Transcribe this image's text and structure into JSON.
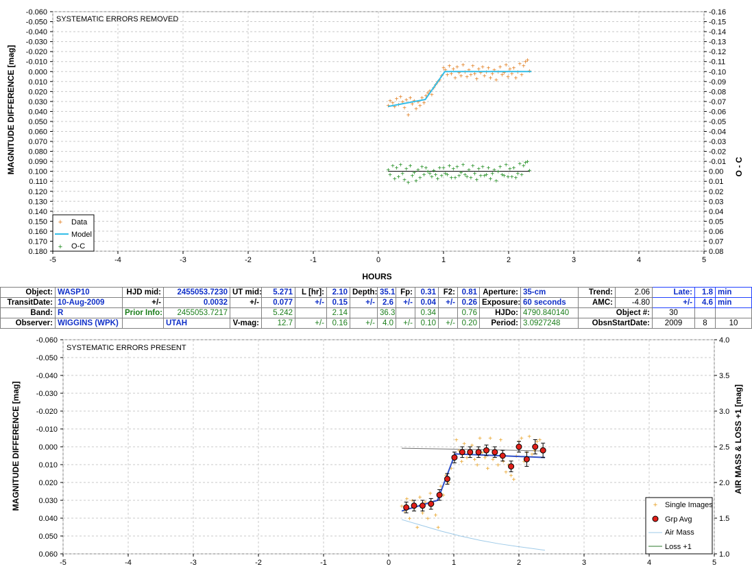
{
  "chart_data": [
    {
      "type": "scatter",
      "title": "SYSTEMATIC ERRORS REMOVED",
      "xlabel": "HOURS",
      "ylabel": "MAGNITUDE DIFFERENCE [mag]",
      "y2label": "O - C",
      "xlim": [
        -5,
        5
      ],
      "ylim": [
        -0.06,
        0.18
      ],
      "y2lim": [
        -0.16,
        0.08
      ],
      "y_inverted": true,
      "grid": true,
      "legend_position": "bottom-left",
      "x_ticks": [
        "-5",
        "-4",
        "-3",
        "-2",
        "-1",
        "0",
        "1",
        "2",
        "3",
        "4",
        "5"
      ],
      "y_ticks": [
        "-0.060",
        "-0.050",
        "-0.040",
        "-0.030",
        "-0.020",
        "-0.010",
        "0.000",
        "0.010",
        "0.020",
        "0.030",
        "0.040",
        "0.050",
        "0.060",
        "0.070",
        "0.080",
        "0.090",
        "0.100",
        "0.110",
        "0.120",
        "0.130",
        "0.140",
        "0.150",
        "0.160",
        "0.170",
        "0.180"
      ],
      "y2_ticks": [
        "-0.16",
        "-0.15",
        "-0.14",
        "-0.13",
        "-0.12",
        "-0.11",
        "-0.10",
        "-0.09",
        "-0.08",
        "-0.07",
        "-0.06",
        "-0.05",
        "-0.04",
        "-0.03",
        "-0.02",
        "-0.01",
        "0.00",
        "0.01",
        "0.02",
        "0.03",
        "0.04",
        "0.05",
        "0.06",
        "0.07",
        "0.08"
      ],
      "series": [
        {
          "name": "Data",
          "color": "#e07b1a",
          "marker": "plus",
          "x": [
            0.15,
            0.18,
            0.22,
            0.25,
            0.28,
            0.31,
            0.34,
            0.37,
            0.4,
            0.43,
            0.46,
            0.49,
            0.52,
            0.55,
            0.58,
            0.61,
            0.64,
            0.67,
            0.7,
            0.73,
            0.76,
            0.79,
            0.82,
            0.85,
            0.88,
            0.91,
            0.94,
            0.97,
            1.0,
            1.03,
            1.06,
            1.09,
            1.12,
            1.15,
            1.18,
            1.21,
            1.24,
            1.27,
            1.3,
            1.33,
            1.36,
            1.39,
            1.42,
            1.45,
            1.48,
            1.51,
            1.54,
            1.57,
            1.6,
            1.63,
            1.66,
            1.69,
            1.72,
            1.75,
            1.78,
            1.81,
            1.84,
            1.87,
            1.9,
            1.93,
            1.96,
            1.99,
            2.02,
            2.05,
            2.08,
            2.11,
            2.14,
            2.17,
            2.2,
            2.23,
            2.26,
            2.29,
            2.32
          ],
          "y": [
            0.034,
            0.029,
            0.031,
            0.035,
            0.027,
            0.033,
            0.025,
            0.03,
            0.036,
            0.028,
            0.043,
            0.026,
            0.032,
            0.029,
            0.037,
            0.03,
            0.034,
            0.026,
            0.031,
            0.024,
            0.021,
            0.019,
            0.023,
            0.016,
            0.013,
            0.01,
            0.008,
            0.004,
            -0.004,
            -0.002,
            0.003,
            -0.006,
            0.002,
            -0.003,
            0.006,
            -0.005,
            0.001,
            0.004,
            -0.007,
            0.0,
            0.005,
            -0.002,
            0.003,
            -0.006,
            0.002,
            0.007,
            -0.003,
            0.001,
            -0.005,
            0.004,
            0.0,
            -0.004,
            0.006,
            0.002,
            -0.002,
            0.008,
            0.0,
            -0.005,
            0.003,
            0.001,
            -0.007,
            0.005,
            -0.003,
            0.002,
            -0.004,
            0.006,
            0.0,
            -0.008,
            0.003,
            -0.006,
            -0.01,
            -0.012,
            -0.001
          ]
        },
        {
          "name": "Model",
          "color": "#33bde8",
          "marker": "line",
          "x": [
            0.15,
            0.72,
            1.02,
            2.35
          ],
          "y": [
            0.035,
            0.028,
            0.0,
            0.0
          ]
        },
        {
          "name": "O-C",
          "color": "#1a8a1a",
          "marker": "plus",
          "x": [
            0.15,
            0.18,
            0.22,
            0.25,
            0.28,
            0.31,
            0.34,
            0.37,
            0.4,
            0.43,
            0.46,
            0.49,
            0.52,
            0.55,
            0.58,
            0.61,
            0.64,
            0.67,
            0.7,
            0.73,
            0.76,
            0.79,
            0.82,
            0.85,
            0.88,
            0.91,
            0.94,
            0.97,
            1.0,
            1.03,
            1.06,
            1.09,
            1.12,
            1.15,
            1.18,
            1.21,
            1.24,
            1.27,
            1.3,
            1.33,
            1.36,
            1.39,
            1.42,
            1.45,
            1.48,
            1.51,
            1.54,
            1.57,
            1.6,
            1.63,
            1.66,
            1.69,
            1.72,
            1.75,
            1.78,
            1.81,
            1.84,
            1.87,
            1.9,
            1.93,
            1.96,
            1.99,
            2.02,
            2.05,
            2.08,
            2.11,
            2.14,
            2.17,
            2.2,
            2.23,
            2.26,
            2.29,
            2.32
          ],
          "y": [
            -0.002,
            0.003,
            -0.006,
            0.007,
            -0.004,
            0.005,
            -0.007,
            0.002,
            0.008,
            -0.003,
            0.011,
            -0.006,
            0.004,
            0.001,
            0.009,
            -0.002,
            0.006,
            -0.005,
            0.003,
            -0.004,
            0.0,
            0.002,
            0.005,
            -0.001,
            0.003,
            0.007,
            -0.004,
            0.004,
            -0.004,
            0.002,
            0.003,
            -0.006,
            0.006,
            -0.003,
            0.006,
            -0.005,
            0.004,
            0.001,
            -0.007,
            0.003,
            0.005,
            -0.002,
            0.006,
            -0.006,
            0.002,
            0.008,
            -0.003,
            0.004,
            -0.005,
            0.004,
            0.003,
            -0.004,
            0.007,
            0.002,
            -0.002,
            0.009,
            0.0,
            -0.005,
            0.003,
            0.004,
            -0.007,
            0.005,
            -0.003,
            0.005,
            -0.004,
            0.006,
            0.002,
            -0.008,
            0.003,
            -0.006,
            -0.009,
            -0.01,
            -0.001
          ]
        }
      ]
    },
    {
      "type": "scatter",
      "title": "SYSTEMATIC ERRORS PRESENT",
      "xlabel": "",
      "ylabel": "MAGNITUDE DIFFERENCE [mag]",
      "y2label": "AIR MASS & LOSS +1 [mag]",
      "xlim": [
        -5,
        5
      ],
      "ylim": [
        -0.06,
        0.06
      ],
      "y2lim": [
        1.0,
        4.0
      ],
      "y_inverted": true,
      "grid": true,
      "legend_position": "bottom-right",
      "x_ticks": [
        "-5",
        "-4",
        "-3",
        "-2",
        "-1",
        "0",
        "1",
        "2",
        "3",
        "4",
        "5"
      ],
      "y_ticks": [
        "-0.060",
        "-0.050",
        "-0.040",
        "-0.030",
        "-0.020",
        "-0.010",
        "0.000",
        "0.010",
        "0.020",
        "0.030",
        "0.040",
        "0.050",
        "0.060"
      ],
      "y2_ticks": [
        "1.0",
        "1.5",
        "2.0",
        "2.5",
        "3.0",
        "3.5",
        "4.0"
      ],
      "series": [
        {
          "name": "Single Images",
          "color": "#e8a020",
          "marker": "plus",
          "x": [
            0.2,
            0.24,
            0.28,
            0.32,
            0.36,
            0.4,
            0.44,
            0.48,
            0.52,
            0.56,
            0.6,
            0.64,
            0.68,
            0.72,
            0.76,
            0.8,
            0.84,
            0.88,
            0.92,
            0.96,
            1.0,
            1.04,
            1.08,
            1.12,
            1.16,
            1.2,
            1.24,
            1.28,
            1.32,
            1.36,
            1.4,
            1.44,
            1.48,
            1.52,
            1.56,
            1.6,
            1.64,
            1.68,
            1.72,
            1.76,
            1.8,
            1.84,
            1.88,
            1.92,
            1.96,
            2.0,
            2.04,
            2.08,
            2.12,
            2.16,
            2.2,
            2.24,
            2.28,
            2.32,
            2.36
          ],
          "y": [
            0.033,
            0.036,
            0.029,
            0.04,
            0.03,
            0.034,
            0.045,
            0.028,
            0.037,
            0.031,
            0.04,
            0.026,
            0.032,
            0.038,
            0.045,
            0.022,
            0.027,
            0.016,
            0.02,
            0.012,
            0.006,
            -0.004,
            0.002,
            0.008,
            -0.002,
            0.006,
            0.004,
            -0.001,
            0.007,
            0.01,
            -0.005,
            0.003,
            0.006,
            0.012,
            -0.005,
            0.007,
            0.004,
            0.01,
            -0.004,
            0.008,
            0.014,
            0.01,
            0.016,
            0.018,
            0.005,
            -0.003,
            -0.005,
            0.008,
            0.003,
            -0.006,
            0.004,
            0.002,
            -0.003,
            -0.004,
            0.001
          ]
        },
        {
          "name": "Grp Avg",
          "color": "#e0201a",
          "marker": "circle-errorbar",
          "x": [
            0.27,
            0.39,
            0.52,
            0.65,
            0.78,
            0.9,
            1.01,
            1.13,
            1.25,
            1.38,
            1.5,
            1.63,
            1.75,
            1.88,
            2.0,
            2.12,
            2.25,
            2.37
          ],
          "y": [
            0.034,
            0.033,
            0.033,
            0.032,
            0.027,
            0.018,
            0.006,
            0.003,
            0.003,
            0.003,
            0.002,
            0.003,
            0.005,
            0.011,
            0.0,
            0.007,
            0.0,
            0.002
          ],
          "err": [
            0.003,
            0.003,
            0.003,
            0.003,
            0.003,
            0.003,
            0.003,
            0.003,
            0.003,
            0.003,
            0.003,
            0.003,
            0.003,
            0.003,
            0.003,
            0.004,
            0.004,
            0.004
          ]
        },
        {
          "name": "Air Mass",
          "color": "#9ecae8",
          "marker": "line",
          "x": [
            0.2,
            0.5,
            0.8,
            1.1,
            1.4,
            1.7,
            2.0,
            2.4
          ],
          "y2": [
            1.48,
            1.4,
            1.32,
            1.25,
            1.19,
            1.14,
            1.1,
            1.05
          ]
        },
        {
          "name": "Loss +1",
          "color": "#2a7a2a",
          "marker": "line",
          "x": [
            0.2,
            0.8,
            1.4,
            2.0,
            2.4
          ],
          "y2": [
            2.48,
            2.47,
            2.46,
            2.45,
            2.44
          ]
        },
        {
          "name": "Model fit",
          "color": "#3050c8",
          "marker": "line",
          "x": [
            0.2,
            0.75,
            1.02,
            2.4
          ],
          "y": [
            0.036,
            0.03,
            0.004,
            0.006
          ]
        }
      ]
    }
  ],
  "info_table": {
    "row1": {
      "object_label": "Object:",
      "object": "WASP10",
      "hjdmid_label": "HJD mid:",
      "hjdmid": "2455053.7230",
      "utmid_label": "UT mid:",
      "utmid": "5.271",
      "lhr_label": "L [hr]:",
      "lhr": "2.10",
      "depth_label": "Depth:",
      "depth": "35.1",
      "fp_label": "Fp:",
      "fp": "0.31",
      "f2_label": "F2:",
      "f2": "0.81",
      "aperture_label": "Aperture:",
      "aperture": "35-cm",
      "trend_label": "Trend:",
      "trend": "2.06",
      "late_label": "Late:",
      "late": "1.8",
      "late_unit": "min"
    },
    "row2": {
      "transitdate_label": "TransitDate:",
      "transitdate": "10-Aug-2009",
      "pm1": "+/-",
      "hjd_err": "0.0032",
      "pm2": "+/-",
      "ut_err": "0.077",
      "pm3": "+/-",
      "l_err": "0.15",
      "pm4": "+/-",
      "depth_err": "2.6",
      "pm5": "+/-",
      "fp_err": "0.04",
      "pm6": "+/-",
      "f2_err": "0.26",
      "exposure_label": "Exposure:",
      "exposure": "60 seconds",
      "amc_label": "AMC:",
      "amc": "-4.80",
      "pm7": "+/-",
      "late_err": "4.6",
      "late_unit": "min"
    },
    "row3": {
      "band_label": "Band:",
      "band": "R",
      "prior_label": "Prior Info:",
      "prior_hjd": "2455053.7217",
      "prior_ut": "5.242",
      "prior_l": "2.14",
      "prior_depth": "36.3",
      "prior_fp": "0.34",
      "prior_f2": "0.76",
      "hjdo_label": "HJDo:",
      "hjdo": "4790.840140",
      "objnum_label": "Object #:",
      "objnum": "30"
    },
    "row4": {
      "observer_label": "Observer:",
      "observer": "WIGGINS (WPK)",
      "location": "UTAH",
      "vmag_label": "V-mag:",
      "vmag": "12.7",
      "pm1": "+/-",
      "vmag_err1": "0.16",
      "pm2": "+/-",
      "vmag_err2": "4.0",
      "pm3": "+/-",
      "vmag_err3": "0.10",
      "pm4": "+/-",
      "vmag_err4": "0.20",
      "period_label": "Period:",
      "period": "3.0927248",
      "obsstart_label": "ObsnStartDate:",
      "year": "2009",
      "month": "8",
      "day": "10"
    }
  }
}
